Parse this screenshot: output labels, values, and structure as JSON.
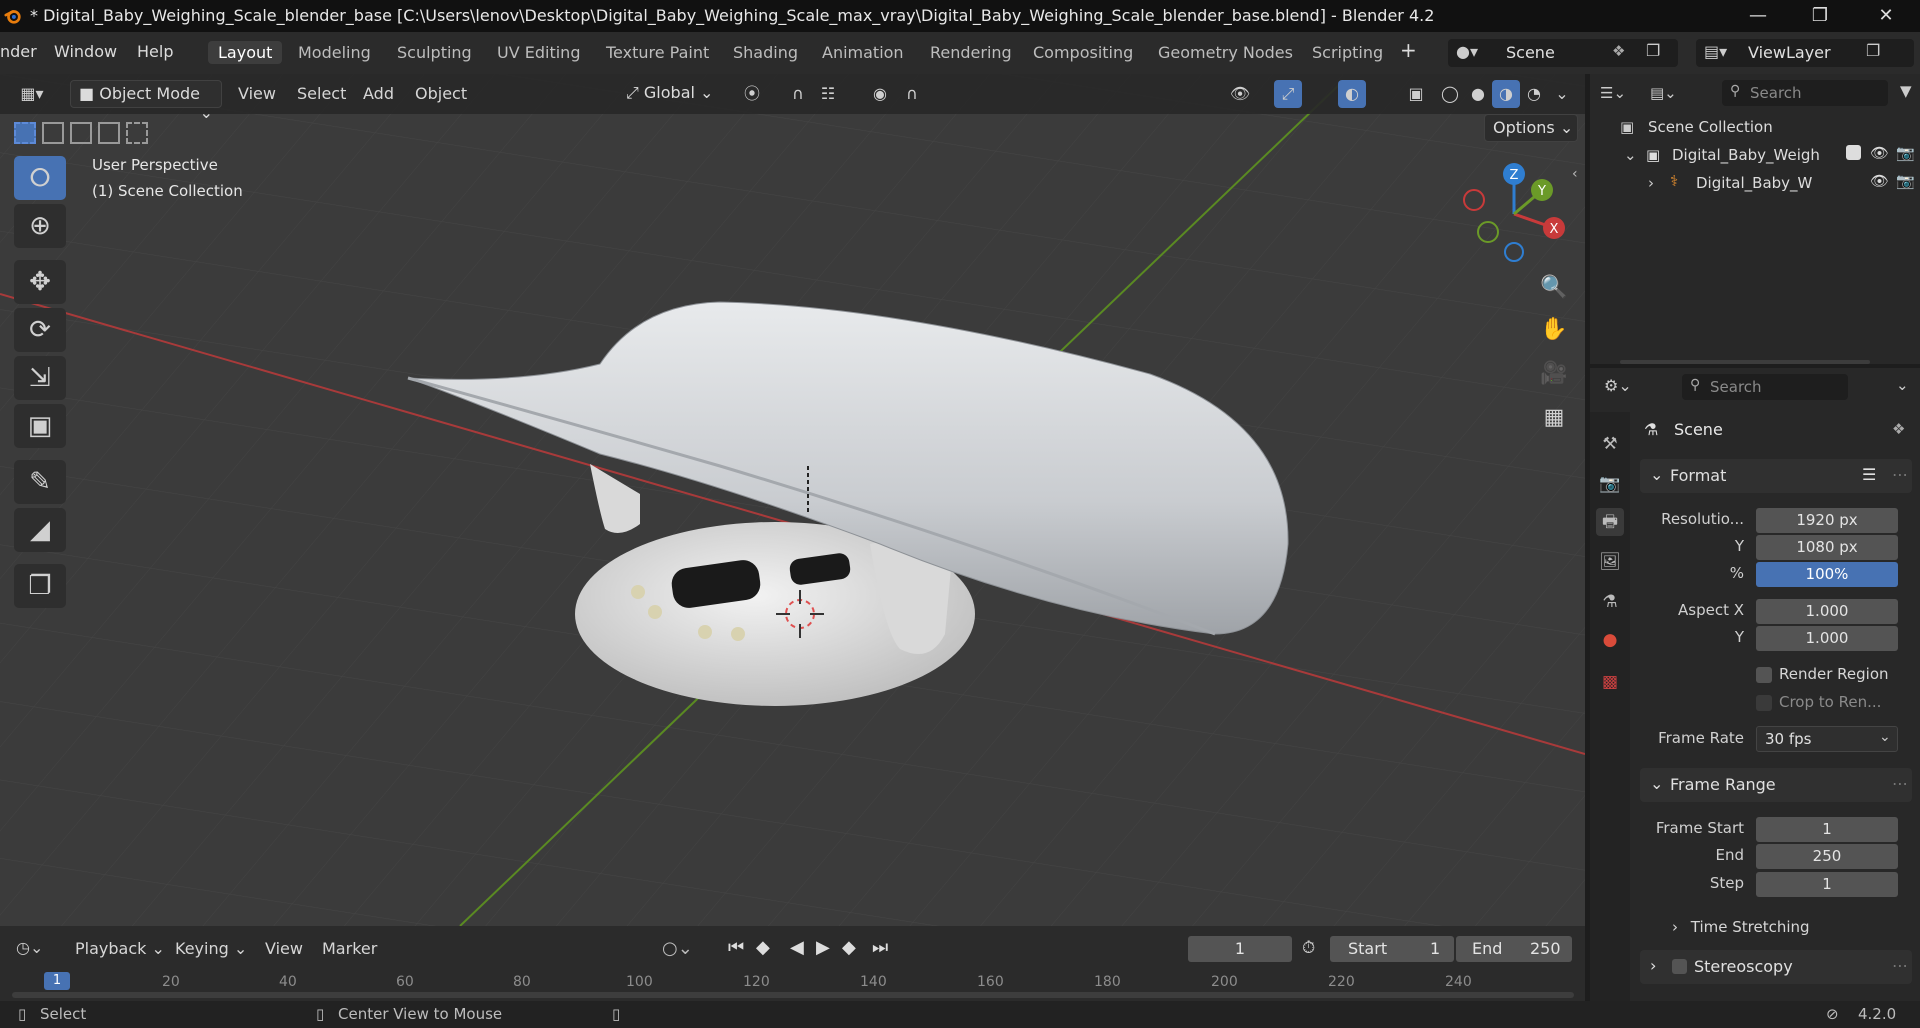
{
  "window": {
    "title": "* Digital_Baby_Weighing_Scale_blender_base [C:\\Users\\lenov\\Desktop\\Digital_Baby_Weighing_Scale_max_vray\\Digital_Baby_Weighing_Scale_blender_base.blend] - Blender 4.2"
  },
  "menu": {
    "items": [
      "nder",
      "Window",
      "Help"
    ]
  },
  "workspaces": [
    "Layout",
    "Modeling",
    "Sculpting",
    "UV Editing",
    "Texture Paint",
    "Shading",
    "Animation",
    "Rendering",
    "Compositing",
    "Geometry Nodes",
    "Scripting"
  ],
  "scene_selector": {
    "value": "Scene"
  },
  "viewlayer_selector": {
    "value": "ViewLayer"
  },
  "viewport": {
    "mode": "Object Mode",
    "menus": [
      "View",
      "Select",
      "Add",
      "Object"
    ],
    "transform_orientation": "Global",
    "options_label": "Options",
    "overlay_line1": "User Perspective",
    "overlay_line2": "(1) Scene Collection",
    "gizmo": {
      "x": "X",
      "y": "Y",
      "z": "Z"
    }
  },
  "outliner": {
    "search_placeholder": "Search",
    "root": "Scene Collection",
    "collection": "Digital_Baby_Weigh",
    "object": "Digital_Baby_W"
  },
  "properties": {
    "search_placeholder": "Search",
    "context": "Scene",
    "format": {
      "title": "Format",
      "resolution_label": "Resolutio...",
      "resolution_x": "1920 px",
      "y_label": "Y",
      "resolution_y": "1080 px",
      "percent_label": "%",
      "percent": "100%",
      "aspect_label": "Aspect X",
      "aspect_x": "1.000",
      "aspect_y_label": "Y",
      "aspect_y": "1.000",
      "render_region": "Render Region",
      "crop": "Crop to Ren...",
      "frame_rate_label": "Frame Rate",
      "frame_rate": "30 fps"
    },
    "frame_range": {
      "title": "Frame Range",
      "start_label": "Frame Start",
      "start": "1",
      "end_label": "End",
      "end": "250",
      "step_label": "Step",
      "step": "1"
    },
    "time_stretching": "Time Stretching",
    "stereoscopy": "Stereoscopy"
  },
  "timeline": {
    "menus": [
      "Playback",
      "Keying",
      "View",
      "Marker"
    ],
    "current_frame": "1",
    "start_label": "Start",
    "start": "1",
    "end_label": "End",
    "end": "250",
    "ruler": [
      "1",
      "20",
      "40",
      "60",
      "80",
      "100",
      "120",
      "140",
      "160",
      "180",
      "200",
      "220",
      "240"
    ]
  },
  "statusbar": {
    "select": "Select",
    "center_view": "Center View to Mouse",
    "version": "4.2.0"
  },
  "colors": {
    "accent": "#4772b3",
    "x_axis": "#c83a3a",
    "y_axis": "#6b9a28",
    "z_axis": "#2f7ed1"
  }
}
